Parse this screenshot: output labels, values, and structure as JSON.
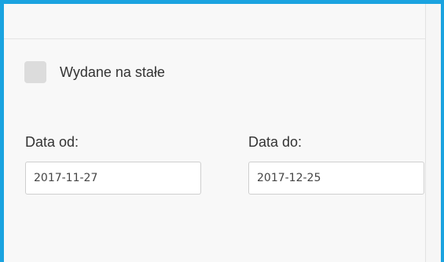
{
  "permanent_issue": {
    "label": "Wydane na stałe",
    "checked": false
  },
  "date_from": {
    "label": "Data od:",
    "value": "2017-11-27"
  },
  "date_to": {
    "label": "Data do:",
    "value": "2017-12-25"
  },
  "colors": {
    "accent_border": "#1aa3e0",
    "checkbox_fill": "#dcdcdc"
  }
}
